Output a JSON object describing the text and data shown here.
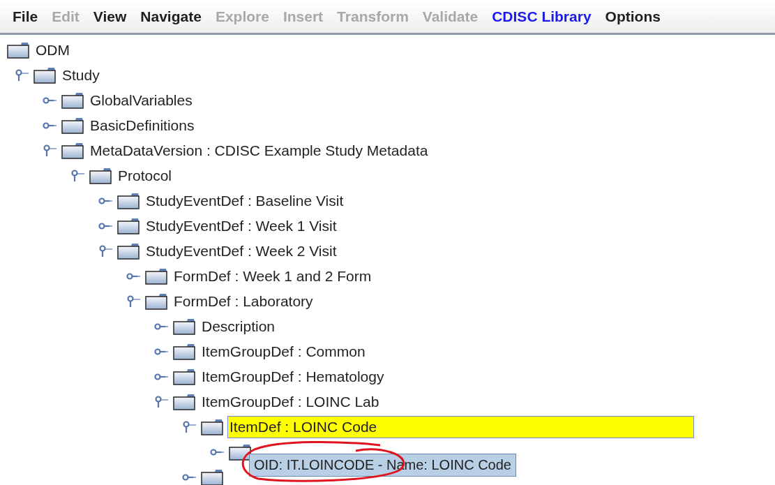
{
  "menu_bar": [
    {
      "label": "File",
      "disabled": false,
      "highlighted": false
    },
    {
      "label": "Edit",
      "disabled": true,
      "highlighted": false
    },
    {
      "label": "View",
      "disabled": false,
      "highlighted": false
    },
    {
      "label": "Navigate",
      "disabled": false,
      "highlighted": false
    },
    {
      "label": "Explore",
      "disabled": true,
      "highlighted": false
    },
    {
      "label": "Insert",
      "disabled": true,
      "highlighted": false
    },
    {
      "label": "Transform",
      "disabled": true,
      "highlighted": false
    },
    {
      "label": "Validate",
      "disabled": true,
      "highlighted": false
    },
    {
      "label": "CDISC Library",
      "disabled": false,
      "highlighted": true
    },
    {
      "label": "Options",
      "disabled": false,
      "highlighted": false
    }
  ],
  "tree": {
    "label": "ODM",
    "selected": false,
    "children": [
      {
        "label": "Study",
        "expanded": true,
        "selected": false,
        "children": [
          {
            "label": "GlobalVariables",
            "expanded": false,
            "selected": false
          },
          {
            "label": "BasicDefinitions",
            "expanded": false,
            "selected": false
          },
          {
            "label": "MetaDataVersion : CDISC Example Study Metadata",
            "expanded": true,
            "selected": false,
            "children": [
              {
                "label": "Protocol",
                "expanded": true,
                "selected": false,
                "children": [
                  {
                    "label": "StudyEventDef : Baseline Visit",
                    "expanded": false,
                    "selected": false
                  },
                  {
                    "label": "StudyEventDef : Week 1 Visit",
                    "expanded": false,
                    "selected": false
                  },
                  {
                    "label": "StudyEventDef : Week 2 Visit",
                    "expanded": true,
                    "selected": false,
                    "children": [
                      {
                        "label": "FormDef : Week 1 and 2 Form",
                        "expanded": false,
                        "selected": false
                      },
                      {
                        "label": "FormDef : Laboratory",
                        "expanded": true,
                        "selected": false,
                        "children": [
                          {
                            "label": "Description",
                            "expanded": false,
                            "selected": false
                          },
                          {
                            "label": "ItemGroupDef : Common",
                            "expanded": false,
                            "selected": false
                          },
                          {
                            "label": "ItemGroupDef : Hematology",
                            "expanded": false,
                            "selected": false
                          },
                          {
                            "label": "ItemGroupDef : LOINC Lab",
                            "expanded": true,
                            "selected": false,
                            "children": [
                              {
                                "label": "ItemDef : LOINC Code",
                                "expanded": true,
                                "selected": true,
                                "children": [
                                  {
                                    "expanded": false,
                                    "selected": false
                                  }
                                ]
                              },
                              {
                                "expanded": false,
                                "selected": false
                              }
                            ]
                          }
                        ]
                      }
                    ]
                  }
                ]
              }
            ]
          }
        ]
      }
    ]
  },
  "tooltip": {
    "oid_label": "OID: IT.LOINCODE",
    "rest": " - Name: LOINC Code"
  }
}
